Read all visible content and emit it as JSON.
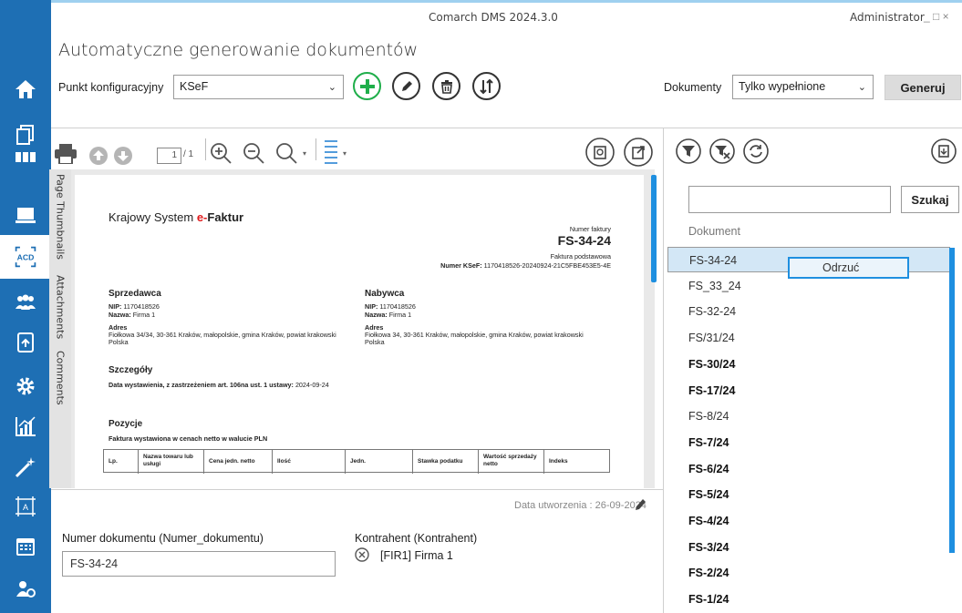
{
  "window": {
    "title": "Comarch DMS 2024.3.0",
    "user": "Administrator",
    "controls": "_ □ ×"
  },
  "page_title": "Automatyczne generowanie dokumentów",
  "toolbar": {
    "config_label": "Punkt konfiguracyjny",
    "config_value": "KSeF",
    "docs_label": "Dokumenty",
    "docs_value": "Tylko wypełnione",
    "generate_label": "Generuj"
  },
  "viewer": {
    "page_current": "1",
    "page_total": "/ 1",
    "side_tabs": [
      "Page Thumbnails",
      "Attachments",
      "Comments"
    ]
  },
  "invoice": {
    "system_title_prefix": "Krajowy System ",
    "system_title_e": "e-",
    "system_title_suffix": "Faktur",
    "number_label": "Numer faktury",
    "number": "FS-34-24",
    "type": "Faktura podstawowa",
    "ksef_label": "Numer KSeF:",
    "ksef_value": "1170418526-20240924-21C5FBE453E5-4E",
    "seller": {
      "heading": "Sprzedawca",
      "nip_label": "NIP:",
      "nip": "1170418526",
      "name_label": "Nazwa:",
      "name": "Firma 1",
      "addr_label": "Adres",
      "addr": "Fiołkowa 34/34, 30-361 Kraków, małopolskie, gmina Kraków, powiat krakowski",
      "country": "Polska"
    },
    "buyer": {
      "heading": "Nabywca",
      "nip_label": "NIP:",
      "nip": "1170418526",
      "name_label": "Nazwa:",
      "name": "Firma 1",
      "addr_label": "Adres",
      "addr": "Fiołkowa 34, 30-361 Kraków, małopolskie, gmina Kraków, powiat krakowski",
      "country": "Polska"
    },
    "details_heading": "Szczegóły",
    "details_label": "Data wystawienia, z zastrzeżeniem art. 106na ust. 1 ustawy:",
    "details_value": "2024-09-24",
    "items_heading": "Pozycje",
    "items_note": "Faktura wystawiona w cenach netto w walucie PLN",
    "columns": [
      "Lp.",
      "Nazwa towaru lub usługi",
      "Cena jedn. netto",
      "Ilość",
      "Jedn.",
      "Stawka podatku",
      "Wartość sprzedaży netto",
      "Indeks"
    ]
  },
  "form": {
    "created": "Data utworzenia : 26-09-2024",
    "numdoc_label": "Numer dokumentu (Numer_dokumentu)",
    "numdoc_value": "FS-34-24",
    "contractor_label": "Kontrahent (Kontrahent)",
    "contractor_value": "[FIR1] Firma 1"
  },
  "right_panel": {
    "search_label": "Szukaj",
    "list_header": "Dokument",
    "context_menu_item": "Odrzuć",
    "documents": [
      {
        "name": "FS-34-24",
        "bold": false,
        "selected": true
      },
      {
        "name": "FS_33_24",
        "bold": false
      },
      {
        "name": "FS-32-24",
        "bold": false
      },
      {
        "name": "FS/31/24",
        "bold": false
      },
      {
        "name": "FS-30/24",
        "bold": true
      },
      {
        "name": "FS-17/24",
        "bold": true
      },
      {
        "name": "FS-8/24",
        "bold": false
      },
      {
        "name": "FS-7/24",
        "bold": true
      },
      {
        "name": "FS-6/24",
        "bold": true
      },
      {
        "name": "FS-5/24",
        "bold": true
      },
      {
        "name": "FS-4/24",
        "bold": true
      },
      {
        "name": "FS-3/24",
        "bold": true
      },
      {
        "name": "FS-2/24",
        "bold": true
      },
      {
        "name": "FS-1/24",
        "bold": true
      }
    ]
  },
  "sidebar_icons": [
    "home-icon",
    "documents-icon",
    "grid-icon",
    "monitor-icon",
    "acd-icon",
    "users-icon",
    "document-edit-icon",
    "gear-icon",
    "chart-icon",
    "wand-icon",
    "template-icon",
    "calendar-icon",
    "user-settings-icon"
  ],
  "colors": {
    "sidebar": "#1e6fb4",
    "accent": "#1e8fe0",
    "selected_row": "#d3e7f6",
    "green": "#1fae4a",
    "red_e": "#e0191b"
  }
}
